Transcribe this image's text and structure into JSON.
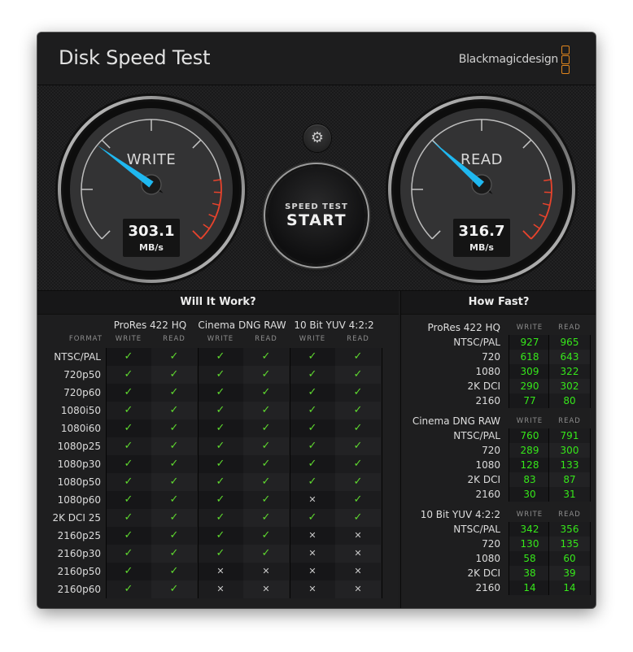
{
  "window": {
    "title": "Disk Speed Test",
    "brand": "Blackmagicdesign",
    "close_label": "×"
  },
  "colors": {
    "accent_needle": "#1fb8f0",
    "redline": "#e8432c",
    "ok": "#5fd92f",
    "value_green": "#36e81a",
    "brand_orange": "#e0851d"
  },
  "gauges": {
    "write": {
      "label": "WRITE",
      "value": "303.1",
      "unit": "MB/s",
      "needle_fraction": 0.3
    },
    "read": {
      "label": "READ",
      "value": "316.7",
      "unit": "MB/s",
      "needle_fraction": 0.32
    }
  },
  "controls": {
    "settings_icon": "⚙",
    "start_line1": "SPEED TEST",
    "start_line2": "START"
  },
  "will_it_work": {
    "title": "Will It Work?",
    "format_header": "FORMAT",
    "codecs": [
      "ProRes 422 HQ",
      "Cinema DNG RAW",
      "10 Bit YUV 4:2:2"
    ],
    "sub_headers": [
      "WRITE",
      "READ",
      "WRITE",
      "READ",
      "WRITE",
      "READ"
    ],
    "rows": [
      {
        "format": "NTSC/PAL",
        "results": [
          true,
          true,
          true,
          true,
          true,
          true
        ]
      },
      {
        "format": "720p50",
        "results": [
          true,
          true,
          true,
          true,
          true,
          true
        ]
      },
      {
        "format": "720p60",
        "results": [
          true,
          true,
          true,
          true,
          true,
          true
        ]
      },
      {
        "format": "1080i50",
        "results": [
          true,
          true,
          true,
          true,
          true,
          true
        ]
      },
      {
        "format": "1080i60",
        "results": [
          true,
          true,
          true,
          true,
          true,
          true
        ]
      },
      {
        "format": "1080p25",
        "results": [
          true,
          true,
          true,
          true,
          true,
          true
        ]
      },
      {
        "format": "1080p30",
        "results": [
          true,
          true,
          true,
          true,
          true,
          true
        ]
      },
      {
        "format": "1080p50",
        "results": [
          true,
          true,
          true,
          true,
          true,
          true
        ]
      },
      {
        "format": "1080p60",
        "results": [
          true,
          true,
          true,
          true,
          false,
          true
        ]
      },
      {
        "format": "2K DCI 25",
        "results": [
          true,
          true,
          true,
          true,
          true,
          true
        ]
      },
      {
        "format": "2160p25",
        "results": [
          true,
          true,
          true,
          true,
          false,
          false
        ]
      },
      {
        "format": "2160p30",
        "results": [
          true,
          true,
          true,
          true,
          false,
          false
        ]
      },
      {
        "format": "2160p50",
        "results": [
          true,
          true,
          false,
          false,
          false,
          false
        ]
      },
      {
        "format": "2160p60",
        "results": [
          true,
          true,
          false,
          false,
          false,
          false
        ]
      }
    ],
    "check_glyph": "✓",
    "cross_glyph": "✕"
  },
  "how_fast": {
    "title": "How Fast?",
    "write_header": "WRITE",
    "read_header": "READ",
    "sections": [
      {
        "codec": "ProRes 422 HQ",
        "rows": [
          {
            "format": "NTSC/PAL",
            "write": "927",
            "read": "965"
          },
          {
            "format": "720",
            "write": "618",
            "read": "643"
          },
          {
            "format": "1080",
            "write": "309",
            "read": "322"
          },
          {
            "format": "2K DCI",
            "write": "290",
            "read": "302"
          },
          {
            "format": "2160",
            "write": "77",
            "read": "80"
          }
        ]
      },
      {
        "codec": "Cinema DNG RAW",
        "rows": [
          {
            "format": "NTSC/PAL",
            "write": "760",
            "read": "791"
          },
          {
            "format": "720",
            "write": "289",
            "read": "300"
          },
          {
            "format": "1080",
            "write": "128",
            "read": "133"
          },
          {
            "format": "2K DCI",
            "write": "83",
            "read": "87"
          },
          {
            "format": "2160",
            "write": "30",
            "read": "31"
          }
        ]
      },
      {
        "codec": "10 Bit YUV 4:2:2",
        "rows": [
          {
            "format": "NTSC/PAL",
            "write": "342",
            "read": "356"
          },
          {
            "format": "720",
            "write": "130",
            "read": "135"
          },
          {
            "format": "1080",
            "write": "58",
            "read": "60"
          },
          {
            "format": "2K DCI",
            "write": "38",
            "read": "39"
          },
          {
            "format": "2160",
            "write": "14",
            "read": "14"
          }
        ]
      }
    ]
  }
}
